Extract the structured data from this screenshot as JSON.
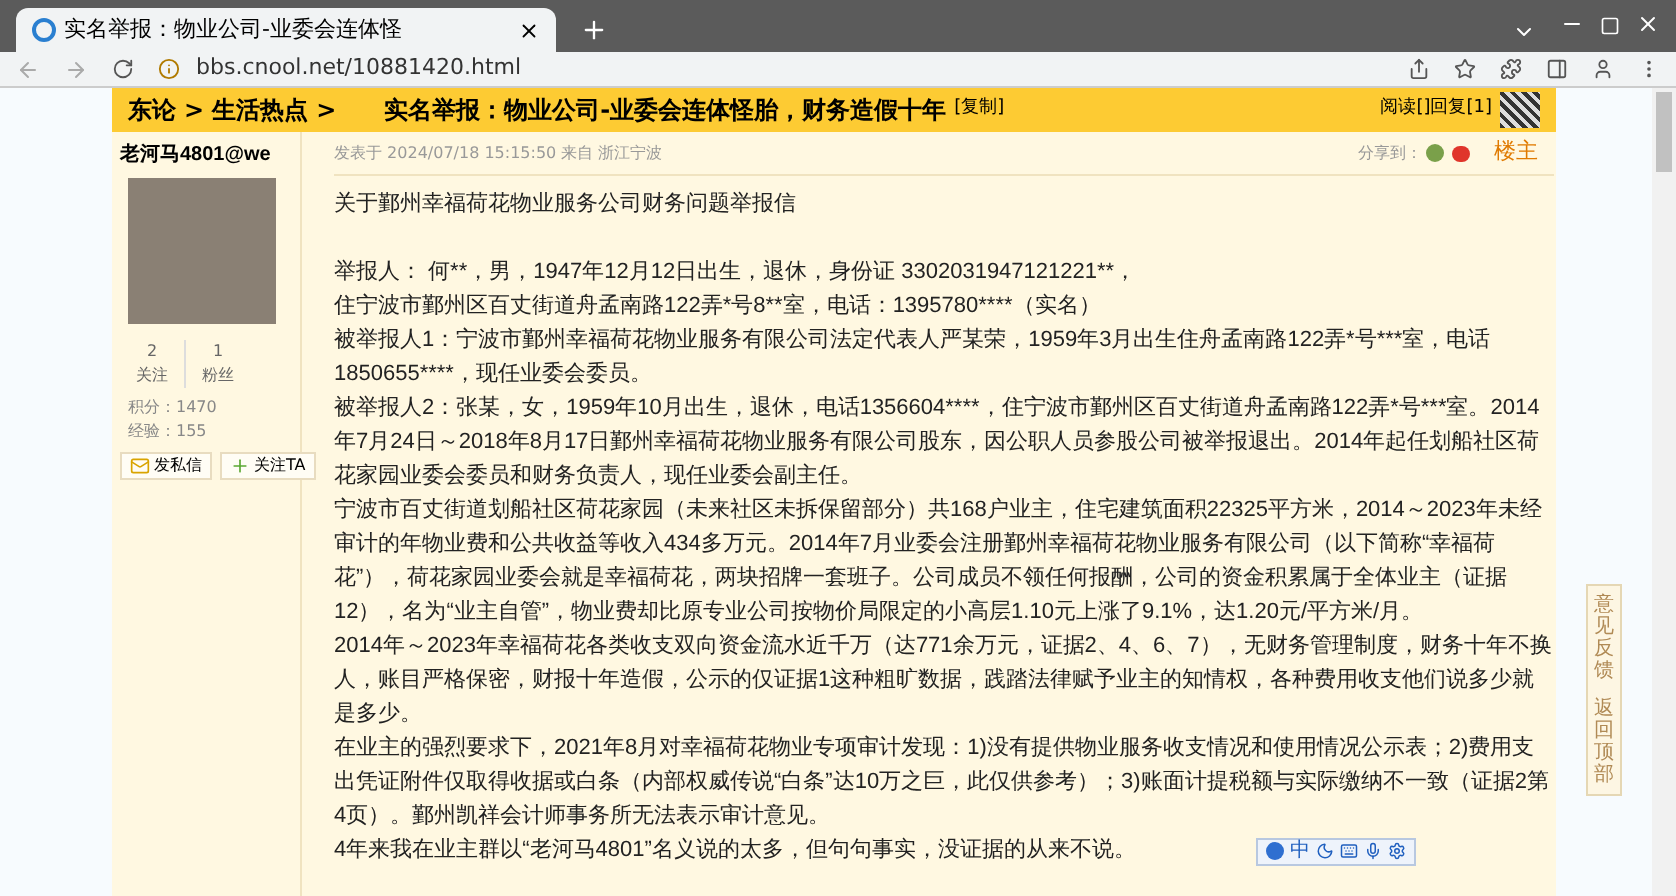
{
  "browser": {
    "tab_title": "实名举报：物业公司-业委会连体怪",
    "url": "bbs.cnool.net/10881420.html"
  },
  "header": {
    "breadcrumbs": [
      {
        "label": "东论"
      },
      {
        "label": "生活热点"
      }
    ],
    "separator": ">",
    "title": "实名举报：物业公司-业委会连体怪胎，财务造假十年",
    "copy_link": "[复制]",
    "stats": "阅读[]回复[1]"
  },
  "author": {
    "name": "老河马4801@we",
    "following": {
      "count": "2",
      "label": "关注"
    },
    "followers": {
      "count": "1",
      "label": "粉丝"
    },
    "points": "积分：1470",
    "experience": "经验：155",
    "buttons": [
      {
        "label": "发私信",
        "kind": "message"
      },
      {
        "label": "关注TA",
        "kind": "follow"
      }
    ]
  },
  "post": {
    "meta": "发表于 2024/07/18 15:15:50 来自 浙江宁波",
    "share_label": "分享到：",
    "floor": "楼主",
    "paragraphs": [
      {
        "text": "关于鄞州幸福荷花物业服务公司财务问题举报信",
        "kind": "title"
      },
      {
        "text": "举报人： 何**，男，1947年12月12日出生，退休，身份证 3302031947121221**，",
        "kind": "body"
      },
      {
        "text": "住宁波市鄞州区百丈街道舟孟南路122弄*号8**室，电话：1395780****（实名）",
        "kind": "body"
      },
      {
        "text": "被举报人1：宁波市鄞州幸福荷花物业服务有限公司法定代表人严某荣，1959年3月出生住舟孟南路122弄*号***室，电话 1850655****，现任业委会委员。",
        "kind": "body"
      },
      {
        "text": "被举报人2：张某，女，1959年10月出生，退休，电话1356604****，住宁波市鄞州区百丈街道舟孟南路122弄*号***室。2014年7月24日～2018年8月17日鄞州幸福荷花物业服务有限公司股东，因公职人员参股公司被举报退出。2014年起任划船社区荷花家园业委会委员和财务负责人，现任业委会副主任。",
        "kind": "body"
      },
      {
        "text": "宁波市百丈街道划船社区荷花家园（未来社区未拆保留部分）共168户业主，住宅建筑面积22325平方米，2014～2023年未经审计的年物业费和公共收益等收入434多万元。2014年7月业委会注册鄞州幸福荷花物业服务有限公司（以下简称“幸福荷花”），荷花家园业委会就是幸福荷花，两块招牌一套班子。公司成员不领任何报酬，公司的资金积累属于全体业主（证据12），名为“业主自管”，物业费却比原专业公司按物价局限定的小高层1.10元上涨了9.1%，达1.20元/平方米/月。",
        "kind": "body"
      },
      {
        "text": "2014年～2023年幸福荷花各类收支双向资金流水近千万（达771余万元，证据2、4、6、7），无财务管理制度，财务十年不换人，账目严格保密，财报十年造假，公示的仅证据1这种粗旷数据，践踏法律赋予业主的知情权，各种费用收支他们说多少就是多少。",
        "kind": "body"
      },
      {
        "text": "在业主的强烈要求下，2021年8月对幸福荷花物业专项审计发现：1)没有提供物业服务收支情况和使用情况公示表；2)费用支出凭证附件仅取得收据或白条（内部权威传说“白条”达10万之巨，此仅供参考）；3)账面计提税额与实际缴纳不一致（证据2第4页）。鄞州凯祥会计师事务所无法表示审计意见。",
        "kind": "body"
      },
      {
        "text": "4年来我在业主群以“老河马4801”名义说的太多，但句句事实，没证据的从来不说。",
        "kind": "body"
      }
    ]
  },
  "ime_toolbar": {
    "mode": "中"
  },
  "side_tabs": [
    {
      "label": "意见反馈"
    },
    {
      "label": "返回顶部"
    }
  ]
}
